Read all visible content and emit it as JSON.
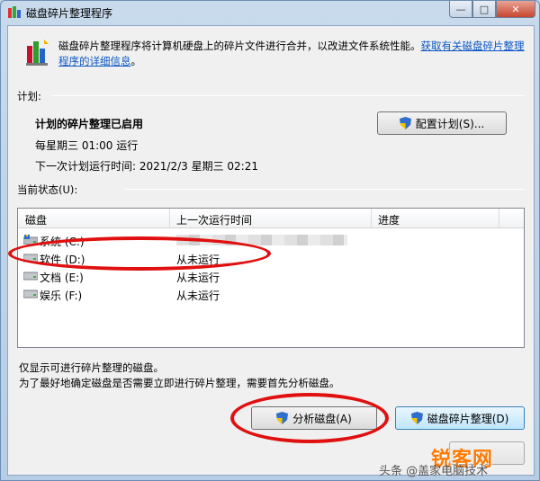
{
  "window": {
    "title": "磁盘碎片整理程序",
    "minimize_glyph": "—",
    "maximize_glyph": "□",
    "close_glyph": "✕"
  },
  "intro": {
    "text": "磁盘碎片整理程序将计算机硬盘上的碎片文件进行合并，以改进文件系统性能。",
    "link": "获取有关磁盘碎片整理程序的详细信息",
    "link_end": "。"
  },
  "schedule": {
    "section_label": "计划:",
    "title": "计划的碎片整理已启用",
    "frequency": "每星期三  01:00 运行",
    "next_run": "下一次计划运行时间: 2021/2/3 星期三 02:21",
    "configure_button": "配置计划(S)..."
  },
  "status": {
    "section_label": "当前状态(U):",
    "columns": [
      "磁盘",
      "上一次运行时间",
      "进度"
    ],
    "rows": [
      {
        "name": "系统 (C:)",
        "last_run": "",
        "icon": "system-drive-icon"
      },
      {
        "name": "软件 (D:)",
        "last_run": "从未运行",
        "icon": "drive-icon"
      },
      {
        "name": "文档 (E:)",
        "last_run": "从未运行",
        "icon": "drive-icon"
      },
      {
        "name": "娱乐 (F:)",
        "last_run": "从未运行",
        "icon": "drive-icon"
      }
    ]
  },
  "footer": {
    "note1": "仅显示可进行碎片整理的磁盘。",
    "note2": "为了最好地确定磁盘是否需要立即进行碎片整理，需要首先分析磁盘。",
    "analyze_button": "分析磁盘(A)",
    "defrag_button": "磁盘碎片整理(D)"
  },
  "watermark": {
    "brand": "锐客网",
    "caption": "头条 @盖家电脑技术"
  },
  "colors": {
    "link": "#0b57c5",
    "annotation": "#e01010"
  }
}
